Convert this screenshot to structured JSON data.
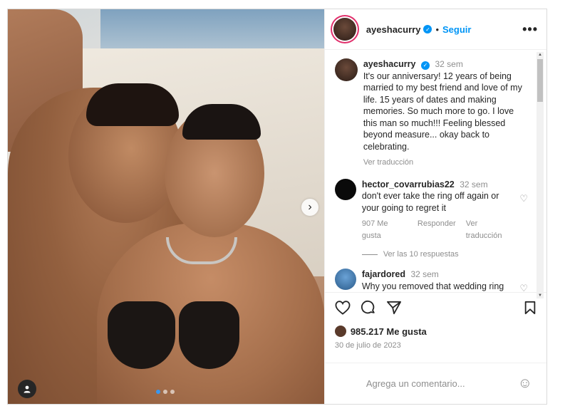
{
  "post": {
    "carousel": {
      "dots": 3,
      "active_index": 0
    },
    "author": {
      "username": "ayeshacurry",
      "verified": true
    },
    "header": {
      "separator": "•",
      "follow_label": "Seguir",
      "more_label": "•••"
    },
    "caption": {
      "username": "ayeshacurry",
      "time": "32 sem",
      "text": "It's our anniversary! 12 years of being married to my best friend and love of my life. 15 years of dates and making memories. So much more to go. I love this man so much!!! Feeling blessed beyond measure... okay back to celebrating.",
      "translate_label": "Ver traducción"
    },
    "comments": [
      {
        "username": "hector_covarrubias22",
        "time": "32 sem",
        "text": "don't ever take the ring off again or your going to regret it",
        "likes": "907 Me gusta",
        "reply_label": "Responder",
        "translate_label": "Ver traducción",
        "see_replies": "Ver las 10 respuestas"
      },
      {
        "username": "fajardored",
        "time": "32 sem",
        "text": "Why you removed that wedding ring though?"
      }
    ],
    "likes_count": "985.217 Me gusta",
    "date": "30 de julio de 2023",
    "comment_placeholder": "Agrega un comentario..."
  },
  "icons": {
    "like": "heart-icon",
    "comment": "comment-icon",
    "share": "share-icon",
    "save": "bookmark-icon",
    "emoji": "emoji-icon",
    "next": "chevron-right-icon",
    "tagged": "user-icon"
  },
  "colors": {
    "accent": "#0095f6",
    "muted": "#8e8e8e",
    "text": "#262626"
  }
}
